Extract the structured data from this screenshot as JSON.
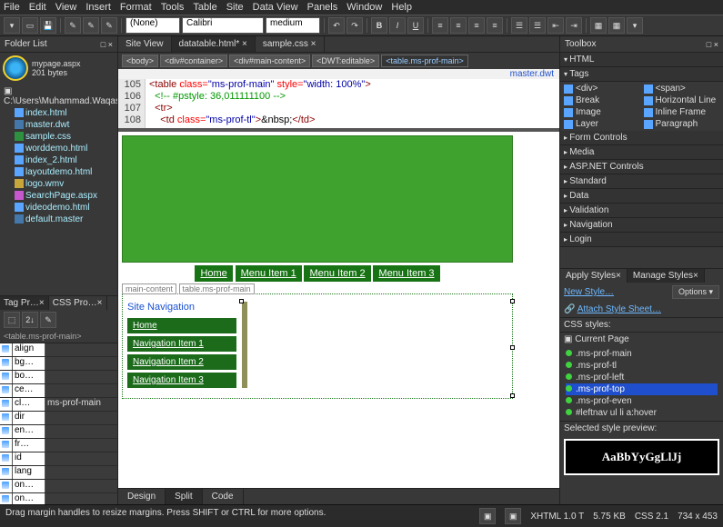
{
  "menu": [
    "File",
    "Edit",
    "View",
    "Insert",
    "Format",
    "Tools",
    "Table",
    "Site",
    "Data View",
    "Panels",
    "Window",
    "Help"
  ],
  "toolbar": {
    "style_sel": "(None)",
    "font_sel": "Calibri",
    "size_sel": "medium"
  },
  "folder_panel": {
    "title": "Folder List",
    "page_name": "mypage.aspx",
    "page_size": "201 bytes",
    "root": "C:\\Users\\Muhammad.Waqas",
    "items": [
      {
        "name": "index.html",
        "type": "html"
      },
      {
        "name": "master.dwt",
        "type": "master"
      },
      {
        "name": "sample.css",
        "type": "css"
      },
      {
        "name": "worddemo.html",
        "type": "html"
      },
      {
        "name": "index_2.html",
        "type": "html"
      },
      {
        "name": "layoutdemo.html",
        "type": "html"
      },
      {
        "name": "logo.wmv",
        "type": "wmv"
      },
      {
        "name": "SearchPage.aspx",
        "type": "aspx"
      },
      {
        "name": "videodemo.html",
        "type": "html"
      },
      {
        "name": "default.master",
        "type": "master"
      }
    ]
  },
  "tag_panel": {
    "tabs": [
      "Tag Pr…",
      "CSS Pro…"
    ],
    "crumb": "<table.ms-prof-main>",
    "rows": [
      {
        "k": "align",
        "v": ""
      },
      {
        "k": "bg…",
        "v": ""
      },
      {
        "k": "bo…",
        "v": ""
      },
      {
        "k": "ce…",
        "v": ""
      },
      {
        "k": "cl…",
        "v": "ms-prof-main"
      },
      {
        "k": "dir",
        "v": ""
      },
      {
        "k": "en…",
        "v": ""
      },
      {
        "k": "fr…",
        "v": ""
      },
      {
        "k": "id",
        "v": ""
      },
      {
        "k": "lang",
        "v": ""
      },
      {
        "k": "on…",
        "v": ""
      },
      {
        "k": "on…",
        "v": ""
      }
    ]
  },
  "center": {
    "tabs": [
      "Site View",
      "datatable.html*",
      "sample.css"
    ],
    "crumbs": [
      "<body>",
      "<div#container>",
      "<div#main-content>",
      "<DWT:editable>",
      "<table.ms-prof-main>"
    ],
    "master_label": "master.dwt",
    "gutter": [
      "105",
      "106",
      "107",
      "108"
    ],
    "code_lines_html": [
      "<span class='c-tag'>&lt;table</span> <span class='c-attr'>class=</span><span class='c-val'>\"ms-prof-main\"</span> <span class='c-attr'>style=</span><span class='c-val'>\"width: 100%\"</span><span class='c-tag'>&gt;</span>",
      "  <span class='c-cmt'>&lt;!-- #pstyle: 36,011111100 --&gt;</span>",
      "  <span class='c-tag'>&lt;tr&gt;</span>",
      "    <span class='c-tag'>&lt;td</span> <span class='c-attr'>class=</span><span class='c-val'>\"ms-prof-tl\"</span><span class='c-tag'>&gt;</span>&amp;nbsp;<span class='c-tag'>&lt;/td&gt;</span>"
    ],
    "menu_items": [
      "Home",
      "Menu Item 1",
      "Menu Item 2",
      "Menu Item 3"
    ],
    "table_label_a": "main-content",
    "table_label_b": "table.ms-prof-main",
    "side_nav_title": "Site Navigation",
    "side_nav": [
      "Home",
      "Navigation Item 1",
      "Navigation Item 2",
      "Navigation Item 3"
    ],
    "view_tabs": [
      "Design",
      "Split",
      "Code"
    ]
  },
  "toolbox": {
    "title": "Toolbox",
    "groups_top": [
      "HTML",
      "Tags"
    ],
    "tag_items": [
      {
        "n": "<div>"
      },
      {
        "n": "<span>"
      },
      {
        "n": "Break"
      },
      {
        "n": "Horizontal Line"
      },
      {
        "n": "Image"
      },
      {
        "n": "Inline Frame"
      },
      {
        "n": "Layer"
      },
      {
        "n": "Paragraph"
      }
    ],
    "groups_rest": [
      "Form Controls",
      "Media",
      "ASP.NET Controls",
      "Standard",
      "Data",
      "Validation",
      "Navigation",
      "Login"
    ]
  },
  "styles": {
    "tabs": [
      "Apply Styles",
      "Manage Styles"
    ],
    "new_style": "New Style…",
    "attach": "Attach Style Sheet…",
    "options": "Options ▾",
    "section": "CSS styles:",
    "current_page": "Current Page",
    "rules": [
      ".ms-prof-main",
      ".ms-prof-tl",
      ".ms-prof-left",
      ".ms-prof-top",
      ".ms-prof-even",
      "#leftnav ul li a:hover"
    ],
    "selected_rule_idx": 3,
    "preview_title": "Selected style preview:",
    "preview_text": "AaBbYyGgLlJj"
  },
  "status": {
    "hint": "Drag margin handles to resize margins. Press SHIFT or CTRL for more options.",
    "doctype": "XHTML 1.0 T",
    "size": "5.75 KB",
    "css": "CSS 2.1",
    "dim": "734 x 453"
  }
}
